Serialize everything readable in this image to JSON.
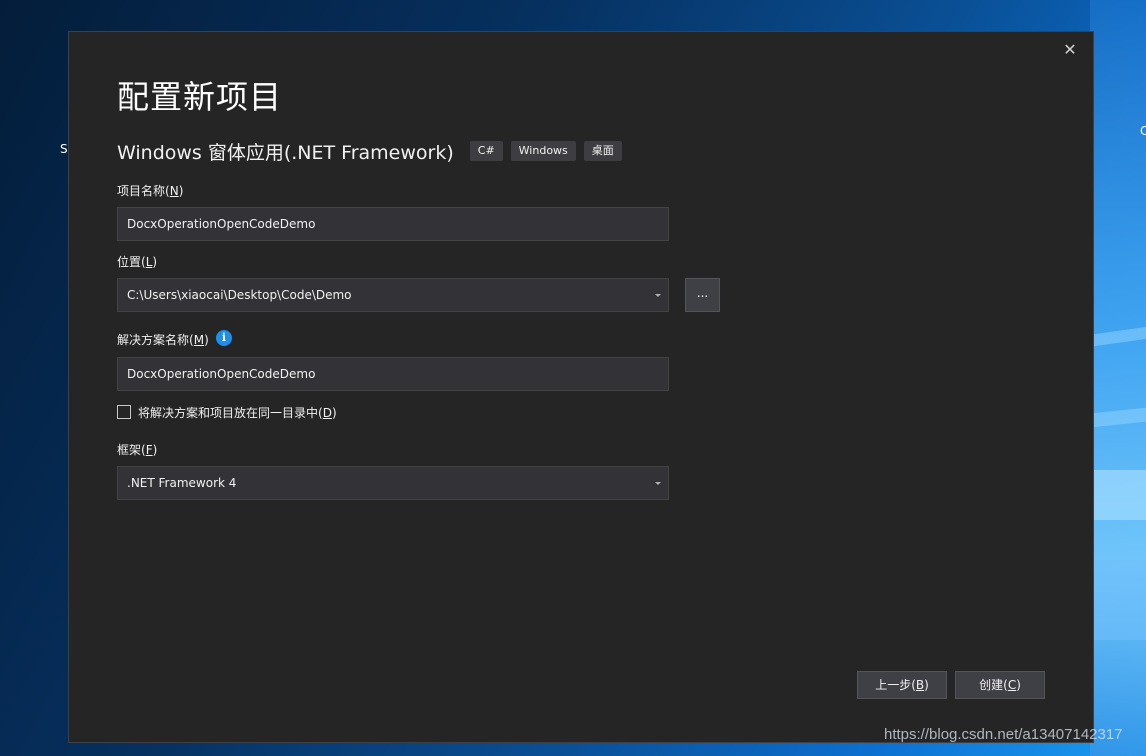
{
  "desktop": {
    "left_text": "S",
    "right_text": "C"
  },
  "dialog": {
    "title": "配置新项目",
    "close_glyph": "✕",
    "template": {
      "name": "Windows 窗体应用(.NET Framework)",
      "tags": [
        "C#",
        "Windows",
        "桌面"
      ]
    },
    "project_name": {
      "label": "项目名称",
      "mnemonic": "N",
      "value": "DocxOperationOpenCodeDemo"
    },
    "location": {
      "label": "位置",
      "mnemonic": "L",
      "value": "C:\\Users\\xiaocai\\Desktop\\Code\\Demo",
      "browse_label": "..."
    },
    "solution_name": {
      "label": "解决方案名称",
      "mnemonic": "M",
      "info_glyph": "i",
      "value": "DocxOperationOpenCodeDemo"
    },
    "same_dir_checkbox": {
      "label": "将解决方案和项目放在同一目录中",
      "mnemonic": "D",
      "checked": false
    },
    "framework": {
      "label": "框架",
      "mnemonic": "F",
      "value": ".NET Framework 4"
    },
    "buttons": {
      "back": {
        "label": "上一步",
        "mnemonic": "B"
      },
      "create": {
        "label": "创建",
        "mnemonic": "C"
      }
    }
  },
  "watermark": "https://blog.csdn.net/a13407142317"
}
